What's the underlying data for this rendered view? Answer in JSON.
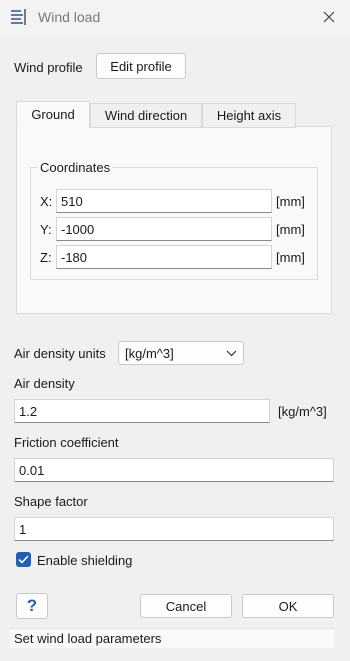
{
  "window": {
    "title": "Wind load",
    "icon": "wind-load-icon",
    "close_icon": "close-icon"
  },
  "wind_profile": {
    "label": "Wind profile",
    "button_label": "Edit profile"
  },
  "tabs": [
    {
      "label": "Ground",
      "active": true
    },
    {
      "label": "Wind direction",
      "active": false
    },
    {
      "label": "Height axis",
      "active": false
    }
  ],
  "coordinates": {
    "group_label": "Coordinates",
    "rows": [
      {
        "label": "X:",
        "value": "510",
        "unit": "[mm]"
      },
      {
        "label": "Y:",
        "value": "-1000",
        "unit": "[mm]"
      },
      {
        "label": "Z:",
        "value": "-180",
        "unit": "[mm]"
      }
    ]
  },
  "air_density_units": {
    "label": "Air density units",
    "selected": "[kg/m^3]"
  },
  "air_density": {
    "label": "Air density",
    "value": "1.2",
    "unit": "[kg/m^3]"
  },
  "friction_coefficient": {
    "label": "Friction coefficient",
    "value": "0.01"
  },
  "shape_factor": {
    "label": "Shape factor",
    "value": "1"
  },
  "enable_shielding": {
    "label": "Enable shielding",
    "checked": true
  },
  "buttons": {
    "help": "?",
    "cancel": "Cancel",
    "ok": "OK"
  },
  "status": "Set wind load parameters",
  "colors": {
    "accent": "#1f5fb4",
    "background": "#f0f0f0",
    "panel": "#f9f9f9"
  }
}
